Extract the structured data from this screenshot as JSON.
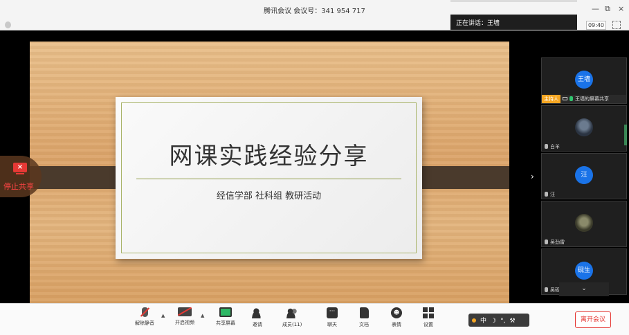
{
  "window": {
    "title": "腾讯会议 会议号：341 954 717",
    "minimize_label": "—",
    "restore_label": "⧉",
    "close_label": "×"
  },
  "speaking": {
    "label": "正在讲话：王墙"
  },
  "subbar": {
    "timer": "09:40"
  },
  "slide": {
    "title": "网课实践经验分享",
    "subtitle": "经信学部  社科组  教研活动"
  },
  "stop_share": {
    "icon_text": "×",
    "label": "停止共享"
  },
  "participants": [
    {
      "avatar_text": "王墙",
      "name": "王墙的屏幕共享",
      "host_badge": "主持人"
    },
    {
      "avatar_text": "",
      "name": "白羊"
    },
    {
      "avatar_text": "汪",
      "name": "汪"
    },
    {
      "avatar_text": "",
      "name": "吴劲雷"
    },
    {
      "avatar_text": "砚生",
      "name": "吴砚生"
    }
  ],
  "expand_more": "⌄",
  "collapse_arrow": "›",
  "toolbar": {
    "items": [
      {
        "label": "解除静音"
      },
      {
        "label": "开启视频"
      },
      {
        "label": "共享屏幕"
      },
      {
        "label": "邀请"
      },
      {
        "label": "成员(11)"
      },
      {
        "label": "聊天"
      },
      {
        "label": "文档"
      },
      {
        "label": "表情"
      },
      {
        "label": "设置"
      }
    ],
    "caret": "▲",
    "chat_glyph": "···",
    "emoji_glyph": "☻",
    "leave_label": "离开会议"
  },
  "ime": {
    "mode": "中",
    "moon": "☽",
    "dots": "°,",
    "wrench": "⚒"
  },
  "colors": {
    "accent_green": "#2db865",
    "alert_red": "#e53935",
    "avatar_blue": "#1a73e8",
    "host_orange": "#f5a623"
  }
}
